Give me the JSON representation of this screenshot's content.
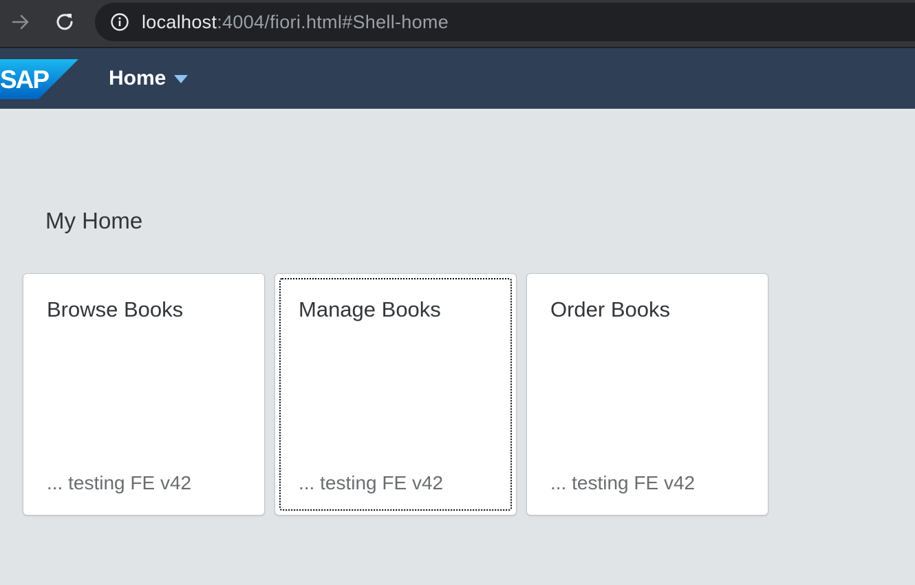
{
  "browser": {
    "url_host": "localhost",
    "url_rest": ":4004/fiori.html#Shell-home"
  },
  "shell": {
    "logo_text": "SAP",
    "home_label": "Home"
  },
  "page": {
    "section_title": "My Home"
  },
  "tiles": [
    {
      "title": "Browse Books",
      "subtitle": "... testing FE v42"
    },
    {
      "title": "Manage Books",
      "subtitle": "... testing FE v42"
    },
    {
      "title": "Order Books",
      "subtitle": "... testing FE v42"
    }
  ],
  "colors": {
    "shell_bg": "#2f3f55",
    "page_bg": "#e1e4e6",
    "caret": "#8ec3f0"
  }
}
